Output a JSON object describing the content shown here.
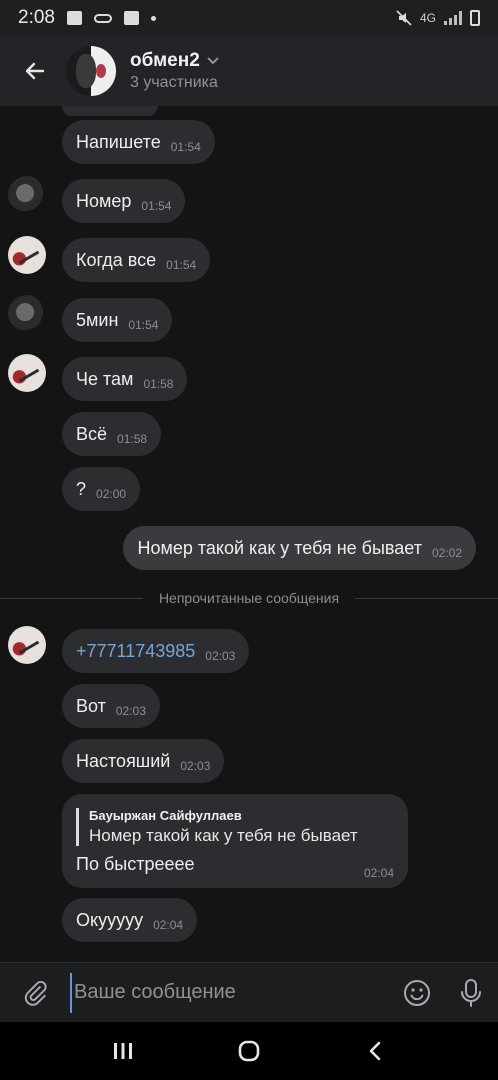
{
  "status_bar": {
    "time": "2:08",
    "network": "4G"
  },
  "header": {
    "title": "обмен2",
    "subtitle": "3 участника"
  },
  "messages": [
    {
      "text": "Напишете",
      "time": "01:54"
    },
    {
      "text": "Номер",
      "time": "01:54"
    },
    {
      "text": "Когда все",
      "time": "01:54"
    },
    {
      "text": "5мин",
      "time": "01:54"
    },
    {
      "text": "Че там",
      "time": "01:58"
    },
    {
      "text": "Всё",
      "time": "01:58"
    },
    {
      "text": "?",
      "time": "02:00"
    },
    {
      "text": "Номер такой как у тебя не бывает",
      "time": "02:02"
    },
    {
      "text": "+77711743985",
      "time": "02:03"
    },
    {
      "text": "Вот",
      "time": "02:03"
    },
    {
      "text": "Настояший",
      "time": "02:03"
    },
    {
      "text": "Окууууу",
      "time": "02:04"
    }
  ],
  "divider": {
    "label": "Непрочитанные сообщения"
  },
  "reply": {
    "author": "Бауыржан Сайфуллаев",
    "quoted": "Номер такой как у тебя не бывает",
    "text": "По быстрееее",
    "time": "02:04"
  },
  "composer": {
    "placeholder": "Ваше сообщение"
  },
  "colors": {
    "background": "#141414",
    "bubble": "#2c2d30",
    "link": "#7aa4d6",
    "accent": "#6f8fd6"
  },
  "icons": [
    "back-arrow-icon",
    "chevron-down-icon",
    "attach-icon",
    "emoji-icon",
    "mic-icon",
    "recents-icon",
    "home-icon",
    "nav-back-icon"
  ]
}
